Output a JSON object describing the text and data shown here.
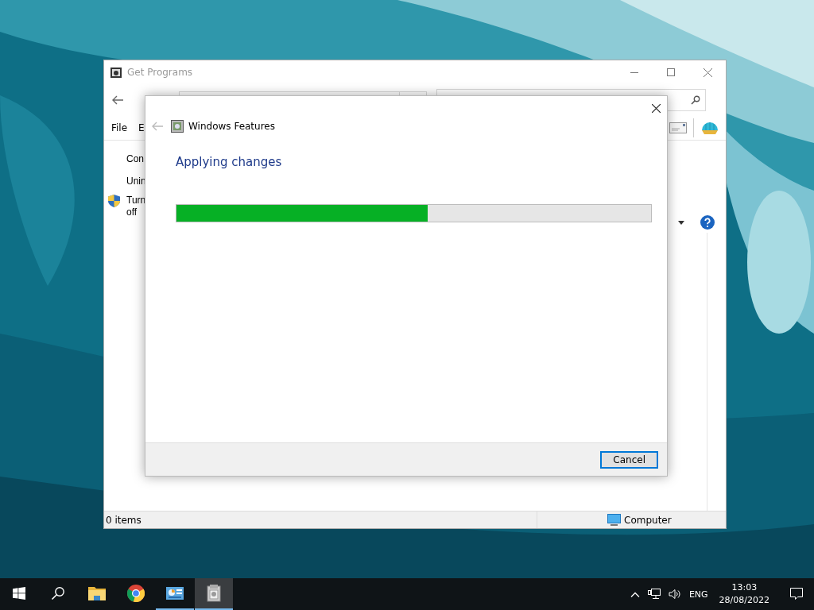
{
  "explorer": {
    "title": "Get Programs",
    "menu": [
      "File",
      "E"
    ],
    "left_pane": [
      "Con",
      "Unin"
    ],
    "shield_link": {
      "lines": [
        "Turn",
        "off"
      ]
    },
    "status_bar": {
      "items": "0 items",
      "location": "Computer"
    }
  },
  "dialog": {
    "title": "Windows Features",
    "heading": "Applying changes",
    "progress": {
      "level": 0.53
    },
    "buttons": [
      "Cancel"
    ]
  },
  "taskbar": {
    "apps": [
      {
        "kind": "start",
        "open": false,
        "selected": false
      },
      {
        "kind": "search",
        "open": false,
        "selected": false
      },
      {
        "kind": "folder",
        "open": false,
        "selected": false
      },
      {
        "kind": "browser",
        "open": false,
        "selected": false
      },
      {
        "kind": "control-panel",
        "open": true,
        "selected": false
      },
      {
        "kind": "features",
        "open": true,
        "selected": true
      }
    ],
    "language": "ENG",
    "time": "13:03",
    "date": "28/08/2022"
  }
}
